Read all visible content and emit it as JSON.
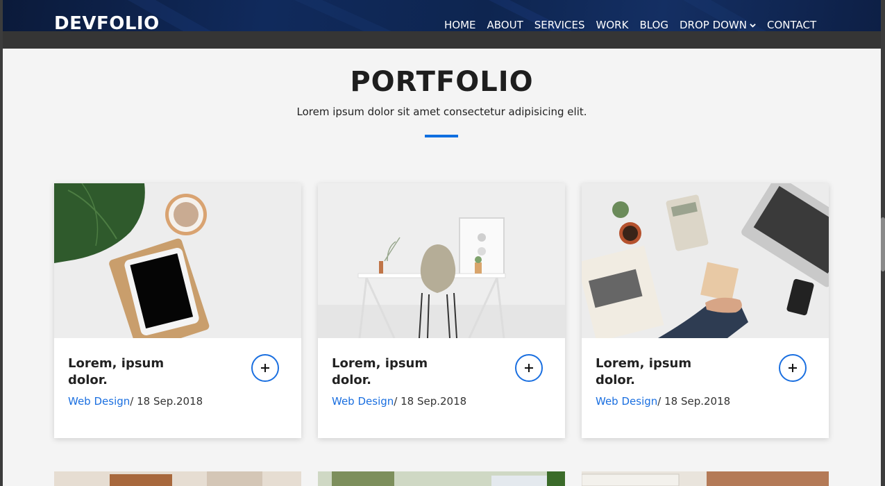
{
  "header": {
    "brand": "DEVFOLIO",
    "nav": [
      {
        "label": "HOME"
      },
      {
        "label": "ABOUT"
      },
      {
        "label": "SERVICES"
      },
      {
        "label": "WORK"
      },
      {
        "label": "BLOG"
      },
      {
        "label": "DROP DOWN",
        "has_dropdown": true
      },
      {
        "label": "CONTACT"
      }
    ]
  },
  "portfolio": {
    "title": "PORTFOLIO",
    "subtitle": "Lorem ipsum dolor sit amet consectetur adipisicing elit.",
    "accent_color": "#0f6fe0",
    "cards": [
      {
        "title": "Lorem, ipsum dolor.",
        "category": "Web Design",
        "date": "/ 18 Sep.2018",
        "image": "plant-tablet-coffee-photo"
      },
      {
        "title": "Lorem, ipsum dolor.",
        "category": "Web Design",
        "date": "/ 18 Sep.2018",
        "image": "desk-chair-photo"
      },
      {
        "title": "Lorem, ipsum dolor.",
        "category": "Web Design",
        "date": "/ 18 Sep.2018",
        "image": "business-desk-photo"
      }
    ]
  }
}
